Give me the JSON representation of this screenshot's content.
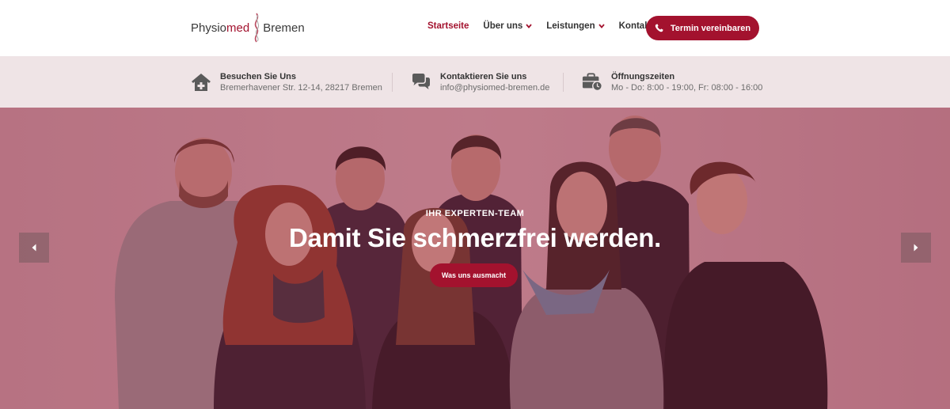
{
  "header": {
    "logo": {
      "left": "Physio",
      "accent": "med",
      "right": "Bremen"
    },
    "nav": [
      {
        "label": "Startseite",
        "active": true,
        "dropdown": false
      },
      {
        "label": "Über uns",
        "active": false,
        "dropdown": true
      },
      {
        "label": "Leistungen",
        "active": false,
        "dropdown": true
      },
      {
        "label": "Kontakt",
        "active": false,
        "dropdown": false
      }
    ],
    "cta": {
      "label": "Termin vereinbaren",
      "icon": "phone-icon"
    }
  },
  "infobar": {
    "address": {
      "title": "Besuchen Sie Uns",
      "text": "Bremerhavener Str. 12-14, 28217 Bremen",
      "icon": "house-plus-icon"
    },
    "contact": {
      "title": "Kontaktieren Sie uns",
      "text": "info@physiomed-bremen.de",
      "icon": "chat-bubbles-icon"
    },
    "hours": {
      "title": "Öffnungszeiten",
      "text": "Mo - Do: 8:00 - 19:00, Fr: 08:00 - 16:00",
      "icon": "briefcase-clock-icon"
    }
  },
  "hero": {
    "kicker": "IHR EXPERTEN-TEAM",
    "headline": "Damit Sie schmerzfrei werden.",
    "button": "Was uns ausmacht",
    "prev_icon": "chevron-left-icon",
    "next_icon": "chevron-right-icon"
  },
  "colors": {
    "brand": "#a3122e",
    "infobar_bg": "#efe4e6",
    "text_dark": "#333333",
    "text_muted": "#6c6c6c"
  }
}
